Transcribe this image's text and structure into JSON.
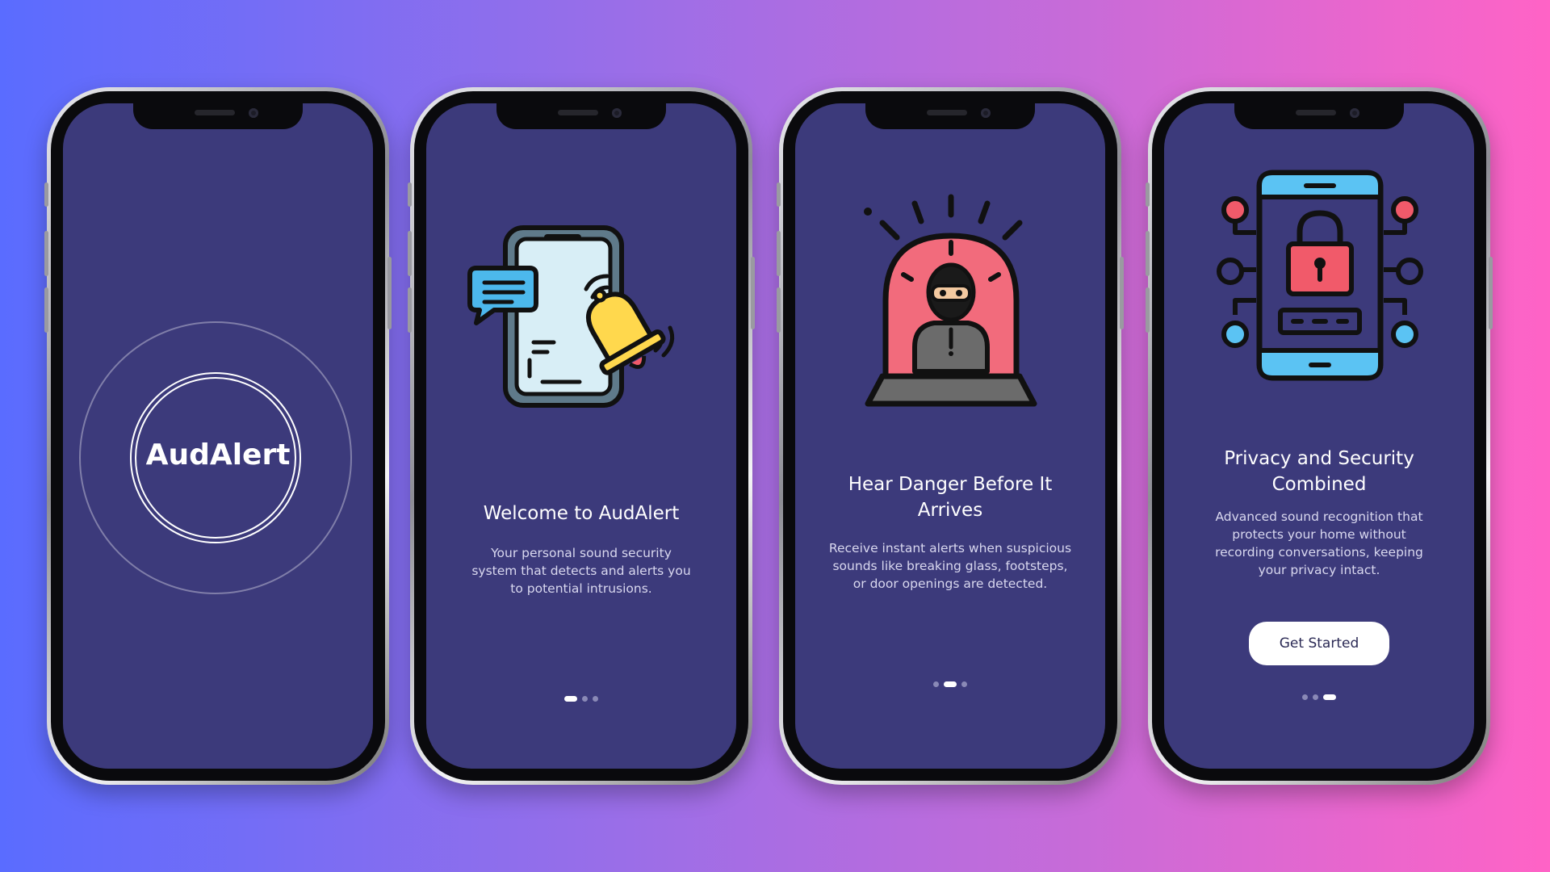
{
  "colors": {
    "screen_bg": "#3c3a7b",
    "accent_white": "#ffffff",
    "alert_red": "#f15a6a",
    "phone_blue": "#5bc3f3"
  },
  "screens": [
    {
      "logo": "AudAlert"
    },
    {
      "icon": "phone-bell-notification-icon",
      "title": "Welcome to AudAlert",
      "body": "Your personal sound security system that detects and alerts you to potential intrusions.",
      "active_dot": 0
    },
    {
      "icon": "intruder-alarm-icon",
      "title_lines": [
        "Hear Danger Before It",
        "Arrives"
      ],
      "body": "Receive instant alerts when suspicious sounds like breaking glass, footsteps, or door openings are detected.",
      "active_dot": 1
    },
    {
      "icon": "phone-lock-security-icon",
      "title_lines": [
        "Privacy and Security",
        "Combined"
      ],
      "body": "Advanced sound recognition that protects your home without recording conversations, keeping your privacy intact.",
      "button": "Get Started",
      "active_dot": 2
    }
  ]
}
